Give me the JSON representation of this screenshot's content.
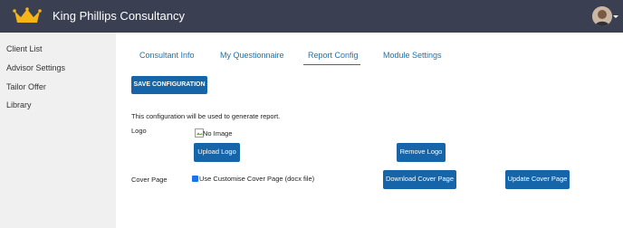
{
  "header": {
    "brand": "King Phillips Consultancy",
    "logo_icon": "crown-icon",
    "avatar_icon": "user-avatar-icon",
    "colors": {
      "bar": "#3a3f51",
      "logo": "#f5b418"
    }
  },
  "sidebar": {
    "items": [
      {
        "label": "Client List"
      },
      {
        "label": "Advisor Settings"
      },
      {
        "label": "Tailor Offer"
      },
      {
        "label": "Library"
      }
    ]
  },
  "tabs": [
    {
      "label": "Consultant Info"
    },
    {
      "label": "My Questionnaire"
    },
    {
      "label": "Report Config",
      "active": true
    },
    {
      "label": "Module Settings"
    }
  ],
  "actions": {
    "save_label": "SAVE CONFIGURATION"
  },
  "report_config": {
    "description": "This configuration will be used to generate report.",
    "logo": {
      "label": "Logo",
      "image_alt": "No Image",
      "upload_label": "Upload Logo",
      "remove_label": "Remove Logo"
    },
    "cover_page": {
      "label": "Cover Page",
      "checkbox_label": "Use Customise Cover Page (docx file)",
      "checked": true,
      "download_label": "Download Cover Page",
      "update_label": "Update Cover Page"
    }
  },
  "colors": {
    "accent": "#1565a8",
    "link": "#1a73b5"
  }
}
